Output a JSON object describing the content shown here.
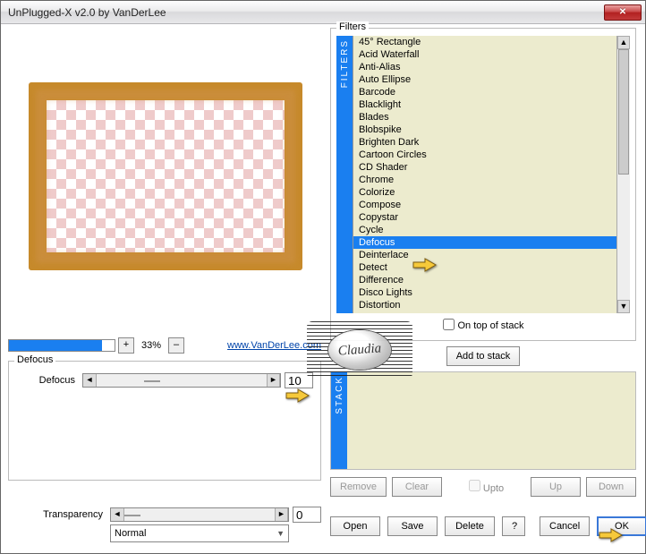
{
  "window": {
    "title": "UnPlugged-X v2.0 by VanDerLee"
  },
  "zoom": {
    "percent": "33%",
    "url": "www.VanDerLee.com"
  },
  "section": {
    "defocus_group": "Defocus",
    "defocus_label": "Defocus",
    "defocus_value": "10"
  },
  "transparency": {
    "label": "Transparency",
    "value": "0",
    "mode": "Normal"
  },
  "filters": {
    "group": "Filters",
    "vlabel": "FILTERS",
    "items": [
      "45° Rectangle",
      "Acid Waterfall",
      "Anti-Alias",
      "Auto Ellipse",
      "Barcode",
      "Blacklight",
      "Blades",
      "Blobspike",
      "Brighten Dark",
      "Cartoon Circles",
      "CD Shader",
      "Chrome",
      "Colorize",
      "Compose",
      "Copystar",
      "Cycle",
      "Defocus",
      "Deinterlace",
      "Detect",
      "Difference",
      "Disco Lights",
      "Distortion"
    ],
    "selected": "Defocus",
    "ontop": "On top of stack"
  },
  "stack": {
    "vlabel": "STACK",
    "add": "Add to stack",
    "remove": "Remove",
    "clear": "Clear",
    "upto": "Upto",
    "up": "Up",
    "down": "Down"
  },
  "dlg": {
    "open": "Open",
    "save": "Save",
    "delete": "Delete",
    "help": "?",
    "cancel": "Cancel",
    "ok": "OK"
  },
  "watermark": "Claudia"
}
